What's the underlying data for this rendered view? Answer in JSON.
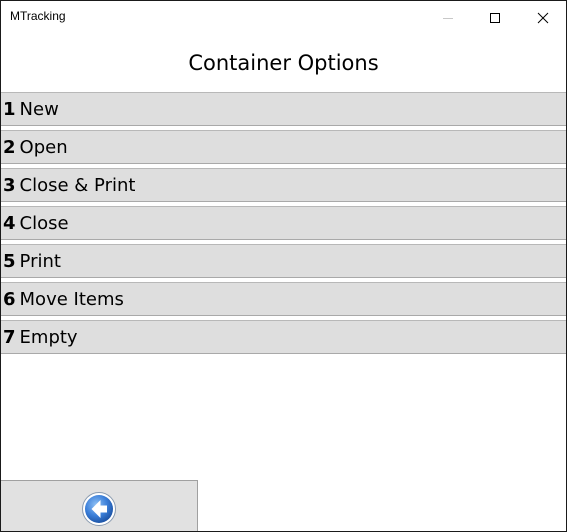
{
  "window": {
    "title": "MTracking",
    "minimize_icon": "minimize-icon",
    "maximize_icon": "maximize-icon",
    "close_icon": "close-icon"
  },
  "header": {
    "title": "Container Options"
  },
  "menu": {
    "items": [
      {
        "number": "1",
        "label": "New"
      },
      {
        "number": "2",
        "label": "Open"
      },
      {
        "number": "3",
        "label": "Close & Print"
      },
      {
        "number": "4",
        "label": "Close"
      },
      {
        "number": "5",
        "label": "Print"
      },
      {
        "number": "6",
        "label": "Move Items"
      },
      {
        "number": "7",
        "label": "Empty"
      }
    ]
  },
  "footer": {
    "back_icon": "back-arrow-icon"
  },
  "colors": {
    "menu_item_bg": "#dedede",
    "back_button_bg": "#e1e1e1",
    "back_icon_blue": "#3b7fd9"
  }
}
